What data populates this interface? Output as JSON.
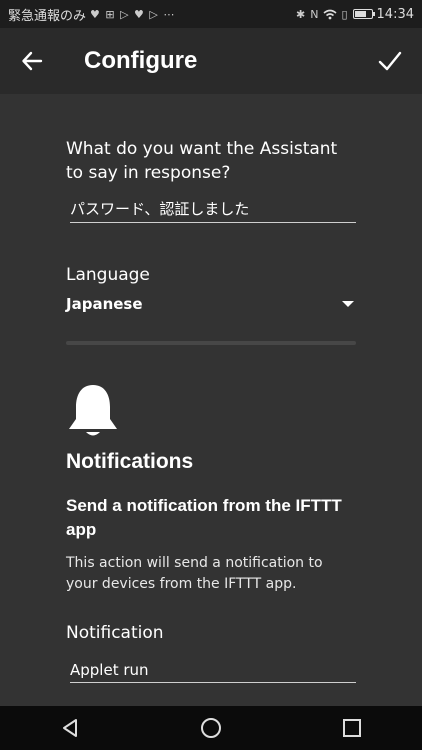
{
  "status_bar": {
    "notification_text": "緊急通報のみ",
    "time": "14:34",
    "battery_level": 0.7
  },
  "app_bar": {
    "title": "Configure"
  },
  "form": {
    "response_label": "What do you want the Assistant to say in response?",
    "response_value": "パスワード、認証しました",
    "language_label": "Language",
    "language_value": "Japanese"
  },
  "notifications": {
    "section_title": "Notifications",
    "subtitle": "Send a notification from the IFTTT app",
    "description": "This action will send a notification to your devices from the IFTTT app.",
    "notification_label": "Notification",
    "notification_value": "Applet run"
  },
  "colors": {
    "background": "#333333",
    "app_bar": "#2a2a2a",
    "status_bar": "#1d1d1d",
    "nav_bar": "#0b0b0b"
  }
}
